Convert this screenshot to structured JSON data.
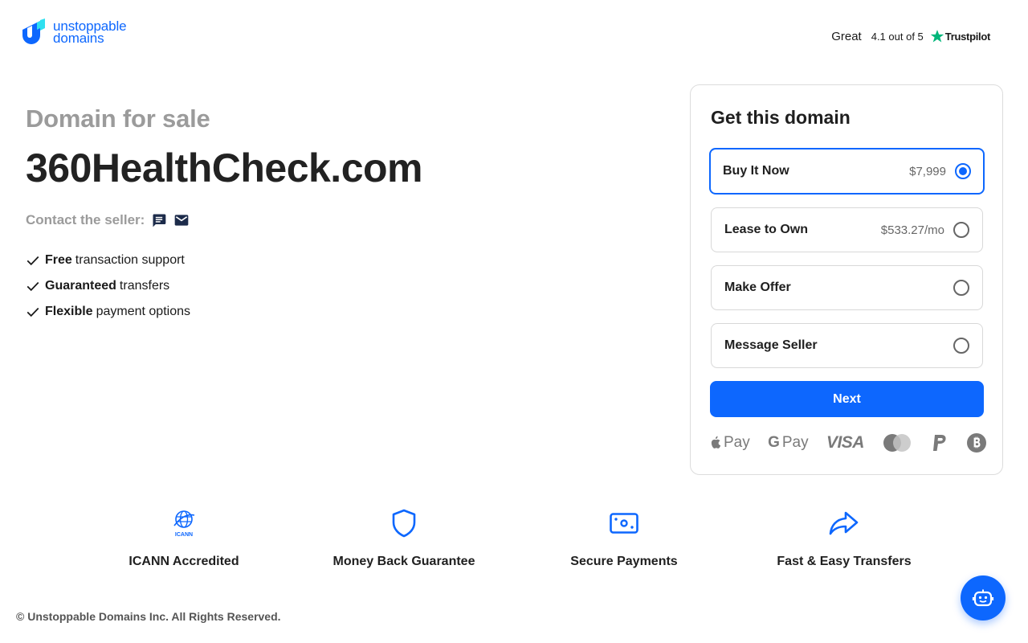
{
  "header": {
    "logo": {
      "line1": "unstoppable",
      "line2": "domains"
    },
    "trustpilot": {
      "rating_word": "Great",
      "score": "4.1 out of 5",
      "brand": "Trustpilot"
    }
  },
  "hero": {
    "kicker": "Domain for sale",
    "domain": "360HealthCheck.com",
    "contact_label": "Contact the seller:",
    "features": [
      {
        "bold": "Free",
        "rest": "transaction support"
      },
      {
        "bold": "Guaranteed",
        "rest": "transfers"
      },
      {
        "bold": "Flexible",
        "rest": "payment options"
      }
    ]
  },
  "card": {
    "title": "Get this domain",
    "options": [
      {
        "label": "Buy It Now",
        "price": "$7,999",
        "selected": true
      },
      {
        "label": "Lease to Own",
        "price": "$533.27/mo",
        "selected": false
      },
      {
        "label": "Make Offer",
        "price": "",
        "selected": false
      },
      {
        "label": "Message Seller",
        "price": "",
        "selected": false
      }
    ],
    "next_label": "Next",
    "payments": {
      "apple": "Pay",
      "google_g": "G",
      "google": "Pay",
      "visa": "VISA"
    }
  },
  "benefits": [
    {
      "label": "ICANN Accredited",
      "icon": "icann-icon",
      "icon_text": "ICANN"
    },
    {
      "label": "Money Back Guarantee",
      "icon": "shield-icon"
    },
    {
      "label": "Secure Payments",
      "icon": "cash-icon"
    },
    {
      "label": "Fast & Easy Transfers",
      "icon": "forward-arrow-icon"
    }
  ],
  "footer": {
    "copyright": "© Unstoppable Domains Inc. All Rights Reserved."
  },
  "colors": {
    "accent": "#0d67fe",
    "trustpilot_green": "#00b67a",
    "muted": "#9b9b9b"
  }
}
